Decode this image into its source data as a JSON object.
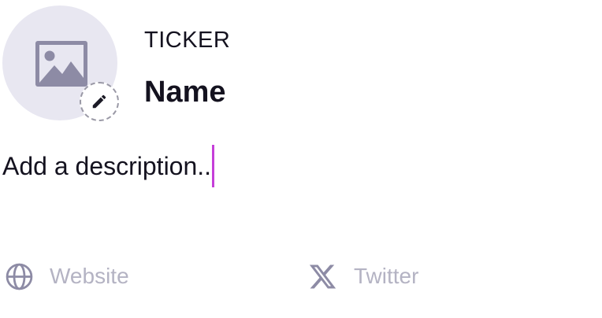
{
  "token": {
    "ticker": "TICKER",
    "name": "Name"
  },
  "description": {
    "placeholder": "Add a description.."
  },
  "links": {
    "website_placeholder": "Website",
    "twitter_placeholder": "Twitter"
  },
  "icons": {
    "avatar": "image-placeholder-icon",
    "edit": "pencil-icon",
    "website": "globe-icon",
    "twitter": "x-logo-icon"
  },
  "colors": {
    "avatar_bg": "#e8e7f1",
    "icon_gray": "#8d8ba5",
    "text_dark": "#14121f",
    "placeholder": "#b4b3c3",
    "caret": "#c53fd9",
    "dashed_border": "#9a99a6"
  }
}
